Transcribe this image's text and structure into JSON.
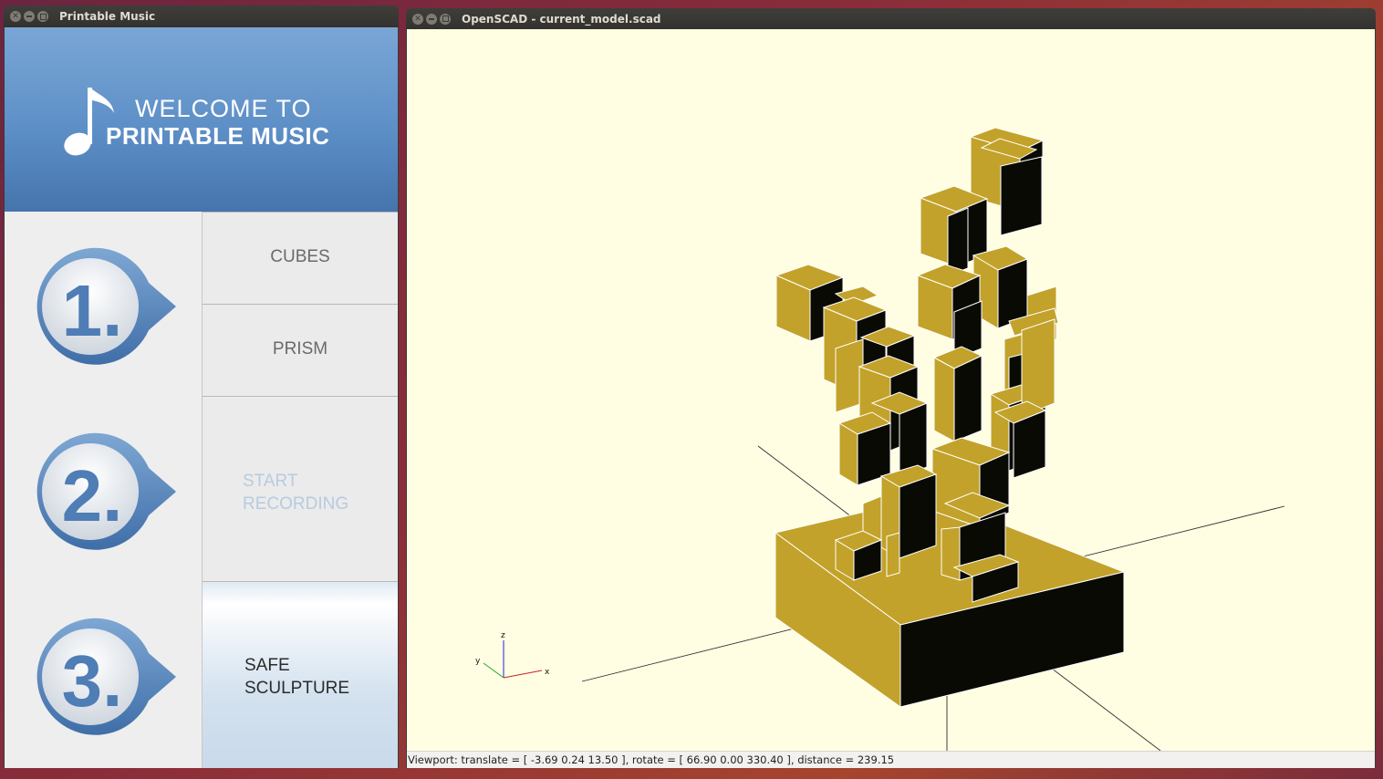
{
  "printable_music": {
    "window_title": "Printable Music",
    "header": {
      "line1": "WELCOME TO",
      "line2": "PRINTABLE MUSIC"
    },
    "steps": [
      {
        "label": "1."
      },
      {
        "label": "2."
      },
      {
        "label": "3."
      }
    ],
    "buttons": {
      "cubes": "CUBES",
      "prism": "PRISM",
      "start_recording_line1": "START",
      "start_recording_line2": "RECORDING",
      "safe_sculpture_line1": "SAFE",
      "safe_sculpture_line2": "SCULPTURE"
    }
  },
  "openscad": {
    "window_title": "OpenSCAD - current_model.scad",
    "axes": {
      "x": "x",
      "y": "y",
      "z": "z"
    },
    "status": "Viewport: translate = [ -3.69 0.24 13.50 ], rotate = [ 66.90 0.00 330.40 ], distance = 239.15"
  },
  "colors": {
    "model_face": "#c2a22a",
    "model_dark": "#0a0a05",
    "viewport_bg": "#fffee3",
    "header_blue": "#5d8fc7",
    "step_blue": "#4f7db5"
  }
}
